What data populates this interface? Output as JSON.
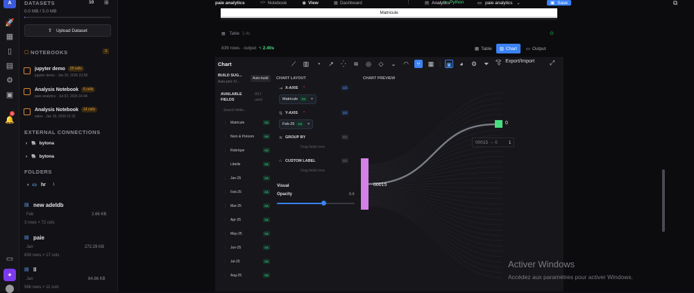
{
  "rail": {
    "avatar": "A",
    "notif_count": "5",
    "icons": [
      "rocket-icon",
      "grid-icon",
      "book-icon",
      "database-icon",
      "settings-icon",
      "box-icon",
      "bell-icon"
    ]
  },
  "sidebar": {
    "datasets_title": "DATASETS",
    "datasets_count": "10",
    "storage": "0.0 MB / 5.0 MB",
    "upload_label": "Upload Dataset",
    "notebooks_title": "NOTEBOOKS",
    "notebooks_count": "3",
    "notebooks": [
      {
        "title": "jupyter demo",
        "badge": "20 cells",
        "sub": "jupyter demo · Jan 25, 2026 22:58"
      },
      {
        "title": "Analysis Notebook",
        "badge": "5 cells",
        "sub": "paie analytics · Jul 03, 2026 16:44"
      },
      {
        "title": "Analysis Notebook",
        "badge": "14 cells",
        "sub": "sales · Jan 18, 2026 21:31"
      }
    ],
    "connections_title": "EXTERNAL CONNECTIONS",
    "connections": [
      "bytona",
      "bytona"
    ],
    "folders_title": "FOLDERS",
    "folder": {
      "name": "hr",
      "count": "1"
    },
    "files": [
      {
        "name": "new adeldb",
        "date": "Feb",
        "size": "2.66 KB",
        "meta": "3 rows × 72 cols"
      },
      {
        "name": "paie",
        "date": "Jan",
        "size": "272.29 KB",
        "meta": "839 rows × 17 cols"
      },
      {
        "name": "ll",
        "date": "Jan",
        "size": "84.86 KB",
        "meta": "566 rows × 11 cols"
      }
    ]
  },
  "topbar": {
    "project": "paie analytics",
    "notebook_label": "Notebook",
    "view_label": "View",
    "dashboard_label": "Dashboard",
    "analytics_label": "Analytics",
    "python_label": "Python",
    "select_value": "paie analytics",
    "save_label": "Save"
  },
  "output": {
    "column_header": "Matricule",
    "table_label": "Table",
    "table_time": "2.4s",
    "rows_label": "839 rows · output",
    "duration": "2.40s",
    "tab_table": "Table",
    "tab_chart": "Chart",
    "tab_output": "Output"
  },
  "chart_panel": {
    "title": "Chart",
    "export_label": "Export/Import",
    "build_title": "BUILD SUG...",
    "build_sub": "Auto-pick X/...",
    "autobuild_label": "Auto-build",
    "available_title": "AVAILABLE FIELDS",
    "available_count": "0/17 used",
    "search_placeholder": "Search fields...",
    "fields": [
      {
        "name": "Matricule",
        "type": "Aa"
      },
      {
        "name": "Nom & Prénom",
        "type": "Aa"
      },
      {
        "name": "Rubrique",
        "type": "Aa"
      },
      {
        "name": "Libelle",
        "type": "Aa"
      },
      {
        "name": "Jan-25",
        "type": "Aa"
      },
      {
        "name": "Feb-25",
        "type": "Aa"
      },
      {
        "name": "Mar-25",
        "type": "Aa"
      },
      {
        "name": "Apr-25",
        "type": "Aa"
      },
      {
        "name": "May-25",
        "type": "Aa"
      },
      {
        "name": "Jun-25",
        "type": "Aa"
      },
      {
        "name": "Jul-25",
        "type": "Aa"
      },
      {
        "name": "Aug-25",
        "type": "Aa"
      }
    ],
    "layout_title": "CHART LAYOUT",
    "xaxis_label": "X-AXIS",
    "xaxis_count": "1/1",
    "xaxis_field": "Matricule",
    "xaxis_type": "Aa",
    "yaxis_label": "Y-AXIS",
    "yaxis_count": "1/1",
    "yaxis_field": "Feb-25",
    "yaxis_type": "Aa",
    "groupby_label": "GROUP BY",
    "groupby_count": "0/1",
    "groupby_drop": "Drag fields here",
    "custom_label": "CUSTOM LABEL",
    "custom_count": "0/1",
    "custom_drop": "Drag fields here",
    "visual_label": "Visual",
    "opacity_label": "Opacity",
    "opacity_value": "0.6",
    "preview_title": "CHART PREVIEW"
  },
  "chart_data": {
    "type": "sankey",
    "source_node": "00015",
    "target_node": "0",
    "tooltip": "00015 → 0",
    "tooltip_value": "1",
    "accent_source": "#d580e8",
    "accent_target": "#4ade80"
  },
  "watermark": {
    "title": "Activer Windows",
    "sub": "Accédez aux paramètres pour activer Windows."
  }
}
